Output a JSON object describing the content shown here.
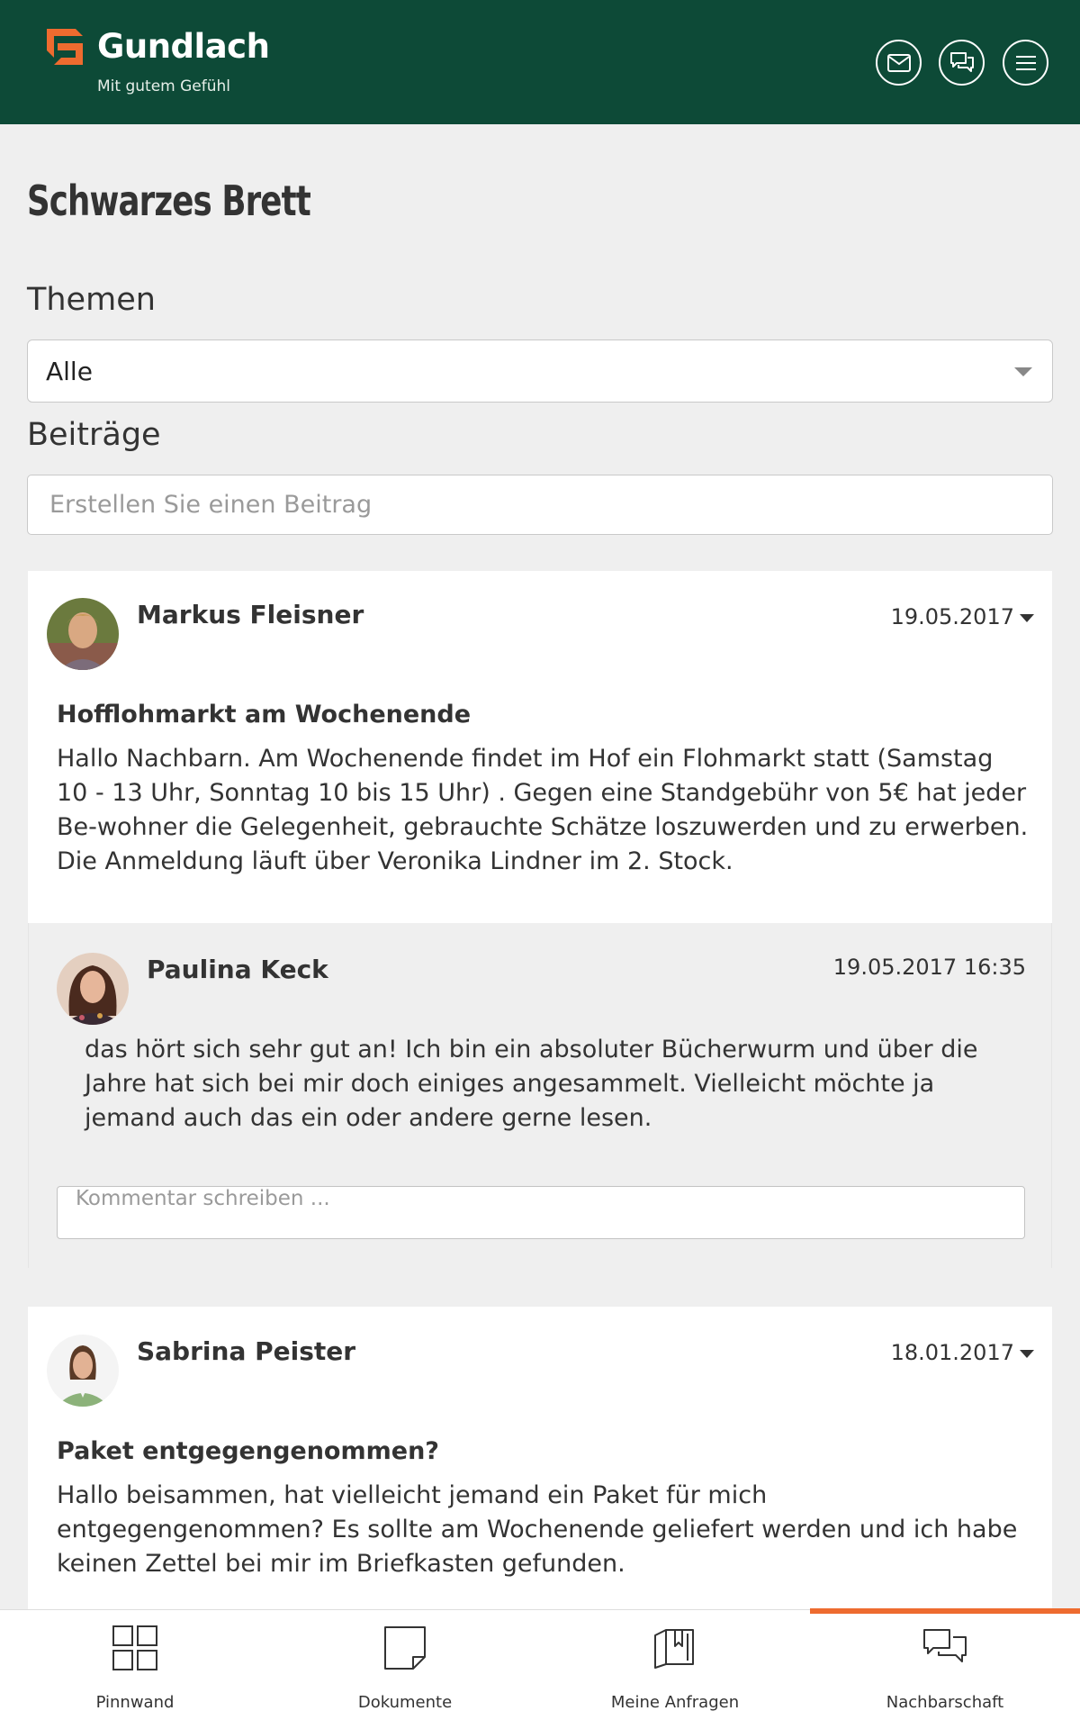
{
  "header": {
    "brand_name": "Gundlach",
    "brand_claim": "Mit gutem Gefühl",
    "brand_color": "#0d4a37",
    "accent_color": "#ee6b2f",
    "icons": [
      "mail-icon",
      "chat-icon",
      "menu-icon"
    ]
  },
  "page": {
    "title": "Schwarzes Brett",
    "topics_label": "Themen",
    "topics_selected": "Alle",
    "posts_label": "Beiträge",
    "create_post_placeholder": "Erstellen Sie einen Beitrag"
  },
  "posts": [
    {
      "author": "Markus Fleisner",
      "date": "19.05.2017",
      "title": "Hofflohmarkt am Wochenende",
      "body": "Hallo Nachbarn. Am Wochenende findet im Hof ein Flohmarkt statt (Samstag 10 - 13 Uhr, Sonntag 10 bis 15 Uhr) . Gegen eine Standgebühr von 5€ hat jeder Be-wohner die Gelegenheit, gebrauchte Schätze loszuwerden und zu erwerben. Die Anmeldung läuft über Veronika Lindner im 2. Stock.",
      "comments": [
        {
          "author": "Paulina Keck",
          "datetime": "19.05.2017 16:35",
          "text": "das hört sich sehr gut an! Ich bin ein absoluter Bücherwurm und über die Jahre hat sich bei mir doch einiges angesammelt. Vielleicht möchte ja jemand auch das ein oder andere gerne lesen."
        }
      ],
      "comment_placeholder": "Kommentar schreiben ..."
    },
    {
      "author": "Sabrina Peister",
      "date": "18.01.2017",
      "title": "Paket entgegengenommen?",
      "body": "Hallo beisammen, hat vielleicht jemand ein Paket für mich entgegengenommen? Es sollte am Wochenende geliefert werden und ich habe keinen Zettel bei mir im Briefkasten gefunden."
    }
  ],
  "bottom_nav": [
    {
      "label": "Pinnwand",
      "icon": "grid-icon",
      "active": false
    },
    {
      "label": "Dokumente",
      "icon": "document-icon",
      "active": false
    },
    {
      "label": "Meine Anfragen",
      "icon": "folder-icon",
      "active": false
    },
    {
      "label": "Nachbarschaft",
      "icon": "chat-bubbles-icon",
      "active": true
    }
  ]
}
